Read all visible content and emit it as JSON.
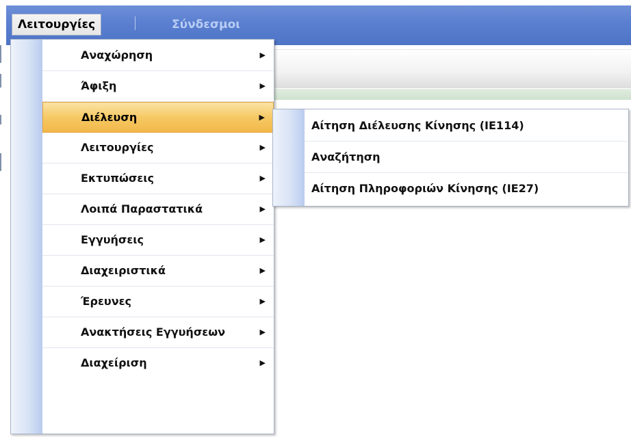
{
  "menubar": {
    "items": [
      {
        "label": "Λειτουργίες"
      },
      {
        "label": "Σύνδεσμοι"
      }
    ]
  },
  "main_menu": {
    "items": [
      {
        "label": "Αναχώρηση",
        "arrow": "▶"
      },
      {
        "label": "Άφιξη",
        "arrow": "▶"
      },
      {
        "label": "Διέλευση",
        "arrow": "▶"
      },
      {
        "label": "Λειτουργίες",
        "arrow": "▶"
      },
      {
        "label": "Εκτυπώσεις",
        "arrow": "▶"
      },
      {
        "label": "Λοιπά Παραστατικά",
        "arrow": "▶"
      },
      {
        "label": "Εγγυήσεις",
        "arrow": "▶"
      },
      {
        "label": "Διαχειριστικά",
        "arrow": "▶"
      },
      {
        "label": "Έρευνες",
        "arrow": "▶"
      },
      {
        "label": "Ανακτήσεις Εγγυήσεων",
        "arrow": "▶"
      },
      {
        "label": "Διαχείριση",
        "arrow": "▶"
      }
    ]
  },
  "sub_menu": {
    "items": [
      {
        "label": "Αίτηση Διέλευσης Κίνησης (IE114)"
      },
      {
        "label": "Αναζήτηση"
      },
      {
        "label": "Αίτηση Πληροφοριών Κίνησης (IE27)"
      }
    ]
  },
  "colors": {
    "menubar": "#5a7fd0",
    "highlight": "#f6c964",
    "rail": "#b9cbee"
  }
}
